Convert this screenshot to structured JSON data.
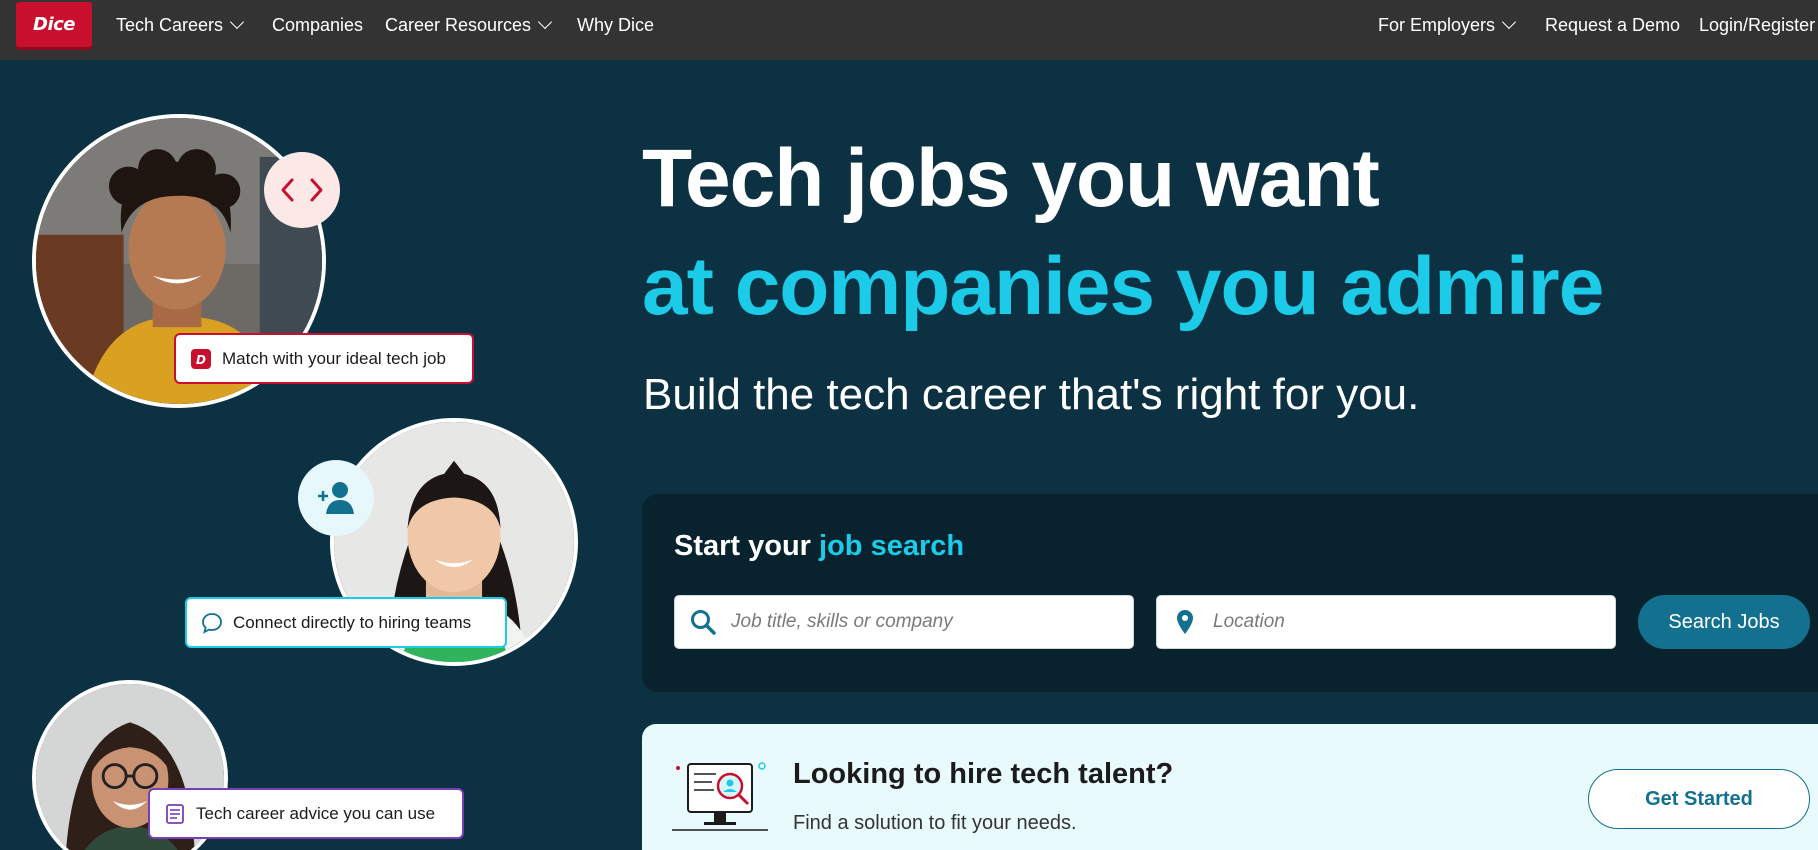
{
  "nav": {
    "logo_text": "Dice",
    "items_left": [
      {
        "label": "Tech Careers",
        "dropdown": true
      },
      {
        "label": "Companies",
        "dropdown": false
      },
      {
        "label": "Career Resources",
        "dropdown": true
      },
      {
        "label": "Why Dice",
        "dropdown": false
      }
    ],
    "items_right": [
      {
        "label": "For Employers",
        "dropdown": true
      },
      {
        "label": "Request a Demo",
        "dropdown": false
      },
      {
        "label": "Login/Register",
        "dropdown": false
      }
    ]
  },
  "collage": {
    "pill_1": "Match with your ideal tech job",
    "pill_2": "Connect directly to hiring teams",
    "pill_3": "Tech career advice you can use"
  },
  "hero": {
    "headline_1": "Tech jobs you want",
    "headline_2": "at companies you admire",
    "subhead": "Build the tech career that's right for you."
  },
  "search": {
    "title_plain": "Start your ",
    "title_accent": "job search",
    "keyword_placeholder": "Job title, skills or company",
    "location_placeholder": "Location",
    "button_label": "Search Jobs"
  },
  "hire": {
    "title": "Looking to hire tech talent?",
    "subtitle": "Find a solution to fit your needs.",
    "button_label": "Get Started"
  },
  "colors": {
    "nav_bg": "#333333",
    "hero_bg": "#0c3142",
    "accent_cyan": "#1ccbe8",
    "brand_red": "#c8102e",
    "button_teal": "#14708f"
  }
}
